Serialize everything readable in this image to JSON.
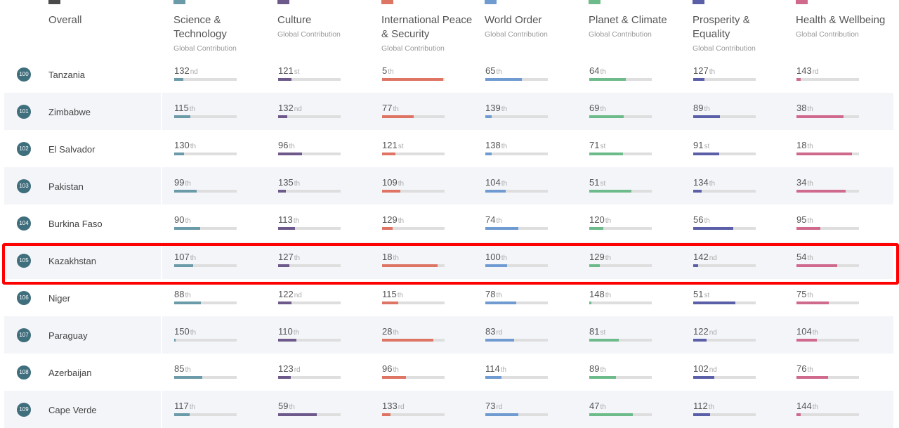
{
  "header": {
    "overall": {
      "label": "Overall",
      "swatch_color": "#4a4a4a"
    },
    "categories": [
      {
        "id": "science",
        "title_lines": [
          "Science &",
          "Technology"
        ],
        "subtitle": "Global Contribution",
        "color": "#6b9aa8"
      },
      {
        "id": "culture",
        "title_lines": [
          "Culture"
        ],
        "subtitle": "Global Contribution",
        "color": "#6d5a8a"
      },
      {
        "id": "peace",
        "title_lines": [
          "International Peace",
          "& Security"
        ],
        "subtitle": "Global Contribution",
        "color": "#de7463"
      },
      {
        "id": "world",
        "title_lines": [
          "World Order"
        ],
        "subtitle": "Global Contribution",
        "color": "#6f9bd1"
      },
      {
        "id": "planet",
        "title_lines": [
          "Planet & Climate"
        ],
        "subtitle": "Global Contribution",
        "color": "#6dbb8a"
      },
      {
        "id": "prosperity",
        "title_lines": [
          "Prosperity &",
          "Equality"
        ],
        "subtitle": "Global Contribution",
        "color": "#5a5fa8"
      },
      {
        "id": "health",
        "title_lines": [
          "Health & Wellbeing"
        ],
        "subtitle": "Global Contribution",
        "color": "#cf6a8d"
      }
    ]
  },
  "total_countries": 153,
  "rows": [
    {
      "rank": "100",
      "country": "Tanzania",
      "scores": [
        [
          "132",
          "nd"
        ],
        [
          "121",
          "st"
        ],
        [
          "5",
          "th"
        ],
        [
          "65",
          "th"
        ],
        [
          "64",
          "th"
        ],
        [
          "127",
          "th"
        ],
        [
          "143",
          "rd"
        ]
      ]
    },
    {
      "rank": "101",
      "country": "Zimbabwe",
      "scores": [
        [
          "115",
          "th"
        ],
        [
          "132",
          "nd"
        ],
        [
          "77",
          "th"
        ],
        [
          "139",
          "th"
        ],
        [
          "69",
          "th"
        ],
        [
          "89",
          "th"
        ],
        [
          "38",
          "th"
        ]
      ]
    },
    {
      "rank": "102",
      "country": "El Salvador",
      "scores": [
        [
          "130",
          "th"
        ],
        [
          "96",
          "th"
        ],
        [
          "121",
          "st"
        ],
        [
          "138",
          "th"
        ],
        [
          "71",
          "st"
        ],
        [
          "91",
          "st"
        ],
        [
          "18",
          "th"
        ]
      ]
    },
    {
      "rank": "103",
      "country": "Pakistan",
      "scores": [
        [
          "99",
          "th"
        ],
        [
          "135",
          "th"
        ],
        [
          "109",
          "th"
        ],
        [
          "104",
          "th"
        ],
        [
          "51",
          "st"
        ],
        [
          "134",
          "th"
        ],
        [
          "34",
          "th"
        ]
      ]
    },
    {
      "rank": "104",
      "country": "Burkina Faso",
      "scores": [
        [
          "90",
          "th"
        ],
        [
          "113",
          "th"
        ],
        [
          "129",
          "th"
        ],
        [
          "74",
          "th"
        ],
        [
          "120",
          "th"
        ],
        [
          "56",
          "th"
        ],
        [
          "95",
          "th"
        ]
      ]
    },
    {
      "rank": "105",
      "country": "Kazakhstan",
      "highlighted": true,
      "scores": [
        [
          "107",
          "th"
        ],
        [
          "127",
          "th"
        ],
        [
          "18",
          "th"
        ],
        [
          "100",
          "th"
        ],
        [
          "129",
          "th"
        ],
        [
          "142",
          "nd"
        ],
        [
          "54",
          "th"
        ]
      ]
    },
    {
      "rank": "106",
      "country": "Niger",
      "scores": [
        [
          "88",
          "th"
        ],
        [
          "122",
          "nd"
        ],
        [
          "115",
          "th"
        ],
        [
          "78",
          "th"
        ],
        [
          "148",
          "th"
        ],
        [
          "51",
          "st"
        ],
        [
          "75",
          "th"
        ]
      ]
    },
    {
      "rank": "107",
      "country": "Paraguay",
      "scores": [
        [
          "150",
          "th"
        ],
        [
          "110",
          "th"
        ],
        [
          "28",
          "th"
        ],
        [
          "83",
          "rd"
        ],
        [
          "81",
          "st"
        ],
        [
          "122",
          "nd"
        ],
        [
          "104",
          "th"
        ]
      ]
    },
    {
      "rank": "108",
      "country": "Azerbaijan",
      "scores": [
        [
          "85",
          "th"
        ],
        [
          "123",
          "rd"
        ],
        [
          "96",
          "th"
        ],
        [
          "114",
          "th"
        ],
        [
          "89",
          "th"
        ],
        [
          "102",
          "nd"
        ],
        [
          "76",
          "th"
        ]
      ]
    },
    {
      "rank": "109",
      "country": "Cape Verde",
      "scores": [
        [
          "117",
          "th"
        ],
        [
          "59",
          "th"
        ],
        [
          "133",
          "rd"
        ],
        [
          "73",
          "rd"
        ],
        [
          "47",
          "th"
        ],
        [
          "112",
          "th"
        ],
        [
          "144",
          "th"
        ]
      ]
    }
  ]
}
